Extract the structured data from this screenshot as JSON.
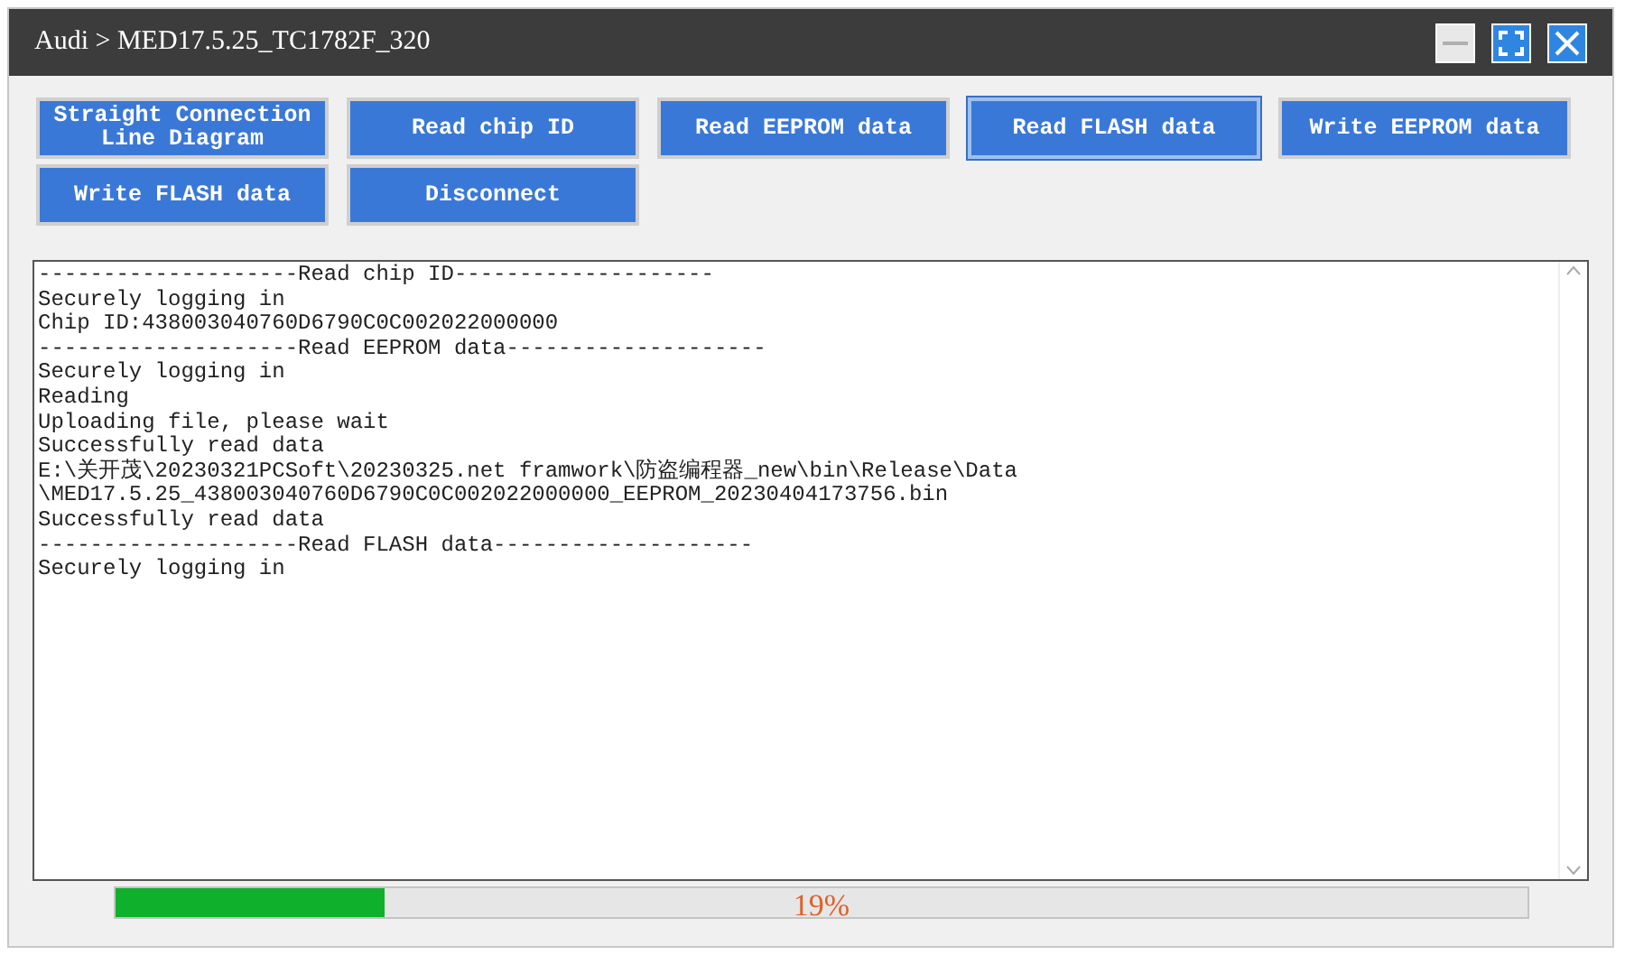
{
  "window": {
    "title": "Audi > MED17.5.25_TC1782F_320"
  },
  "buttons": [
    {
      "label": "Straight Connection Line Diagram",
      "selected": false
    },
    {
      "label": "Read chip ID",
      "selected": false
    },
    {
      "label": "Read EEPROM data",
      "selected": false
    },
    {
      "label": "Read FLASH data",
      "selected": true
    },
    {
      "label": "Write EEPROM data",
      "selected": false
    },
    {
      "label": "Write FLASH data",
      "selected": false
    },
    {
      "label": "Disconnect",
      "selected": false
    }
  ],
  "log": [
    "--------------------Read chip ID--------------------",
    "Securely logging in",
    "Chip ID:438003040760D6790C0C002022000000",
    "--------------------Read EEPROM data--------------------",
    "Securely logging in",
    "Reading",
    "Uploading file, please wait",
    "Successfully read data",
    "E:\\关开茂\\20230321PCSoft\\20230325.net framwork\\防盗编程器_new\\bin\\Release\\Data",
    "\\MED17.5.25_438003040760D6790C0C002022000000_EEPROM_20230404173756.bin",
    "Successfully read data",
    "--------------------Read FLASH data--------------------",
    "Securely logging in"
  ],
  "progress": {
    "level": 0.19,
    "reading": "19%"
  }
}
